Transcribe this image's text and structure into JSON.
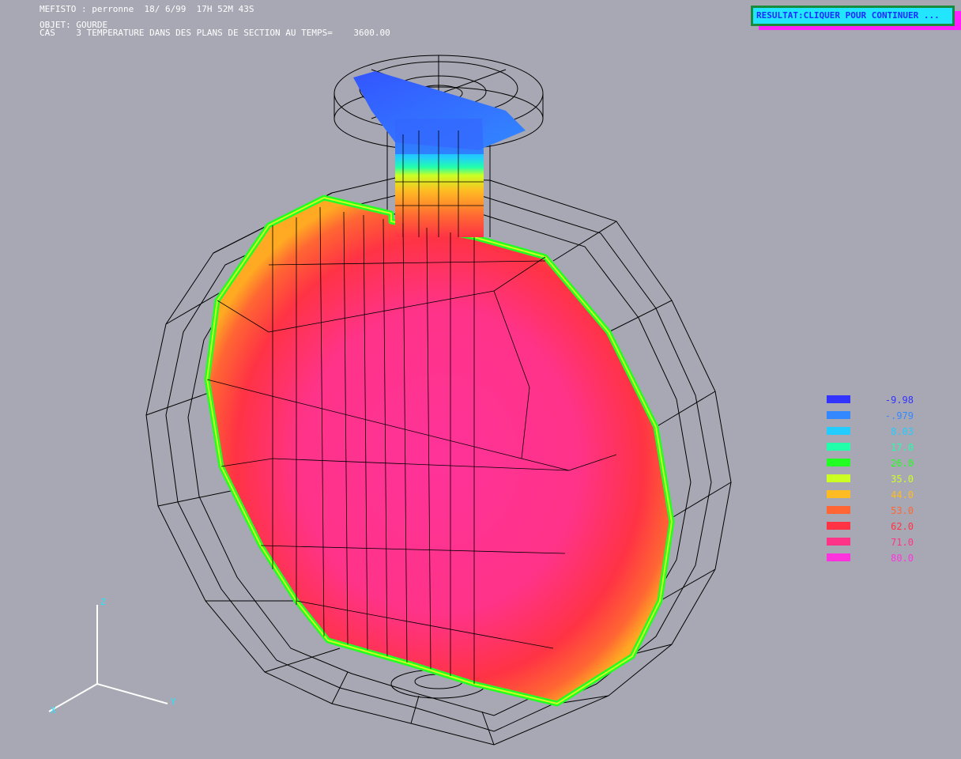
{
  "header": {
    "line1": "MEFISTO : perronne  18/ 6/99  17H 52M 43S",
    "line2": "OBJET: GOURDE",
    "line3": "CAS    3 TEMPERATURE DANS DES PLANS DE SECTION AU TEMPS=    3600.00"
  },
  "continue_button": {
    "label": "RESULTAT:CLIQUER POUR CONTINUER ..."
  },
  "legend": [
    {
      "value": "-9.98",
      "color": "#3333ff"
    },
    {
      "value": "-.979",
      "color": "#3388ff"
    },
    {
      "value": "8.03",
      "color": "#22ccff"
    },
    {
      "value": "17.0",
      "color": "#22ffaa"
    },
    {
      "value": "26.0",
      "color": "#22ff22"
    },
    {
      "value": "35.0",
      "color": "#ccff22"
    },
    {
      "value": "44.0",
      "color": "#ffbb22"
    },
    {
      "value": "53.0",
      "color": "#ff6633"
    },
    {
      "value": "62.0",
      "color": "#ff3344"
    },
    {
      "value": "71.0",
      "color": "#ff3388"
    },
    {
      "value": "80.0",
      "color": "#ff33dd"
    }
  ],
  "axes": {
    "z": "Z",
    "x": "X",
    "y": "Y"
  },
  "colors": {
    "background": "#a8a8b4",
    "mesh": "#000000",
    "axis": "#ffffff",
    "axis_label": "#22e6ff",
    "body_hot": "#ff3388",
    "body_warm": "#ff3344"
  }
}
